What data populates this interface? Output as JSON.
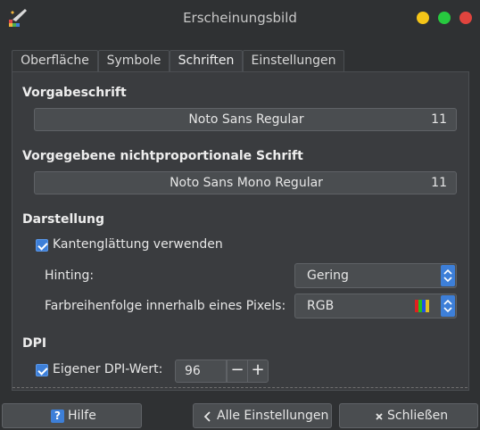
{
  "window": {
    "title": "Erscheinungsbild"
  },
  "tabs": [
    {
      "label": "Oberfläche"
    },
    {
      "label": "Symbole"
    },
    {
      "label": "Schriften"
    },
    {
      "label": "Einstellungen"
    }
  ],
  "default_font": {
    "title": "Vorgabeschrift",
    "name": "Noto Sans Regular",
    "size": "11"
  },
  "mono_font": {
    "title": "Vorgegebene nichtproportionale Schrift",
    "name": "Noto Sans Mono Regular",
    "size": "11"
  },
  "rendering": {
    "title": "Darstellung",
    "antialias_label": "Kantenglättung verwenden",
    "antialias_checked": true,
    "hinting_label": "Hinting:",
    "hinting_value": "Gering",
    "subpixel_label": "Farbreihenfolge innerhalb eines Pixels:",
    "subpixel_value": "RGB",
    "subpixel_icon": "rgb-stripes-icon"
  },
  "dpi": {
    "title": "DPI",
    "custom_label": "Eigener DPI-Wert:",
    "custom_checked": true,
    "value": "96",
    "minus": "−",
    "plus": "+"
  },
  "buttons": {
    "help": "Hilfe",
    "all_settings": "Alle Einstellungen",
    "close": "Schließen"
  },
  "colors": {
    "accent": "#3d7fd8",
    "window_close": "#e0443e",
    "window_maximize": "#27c93f",
    "window_minimize": "#f5c518"
  }
}
